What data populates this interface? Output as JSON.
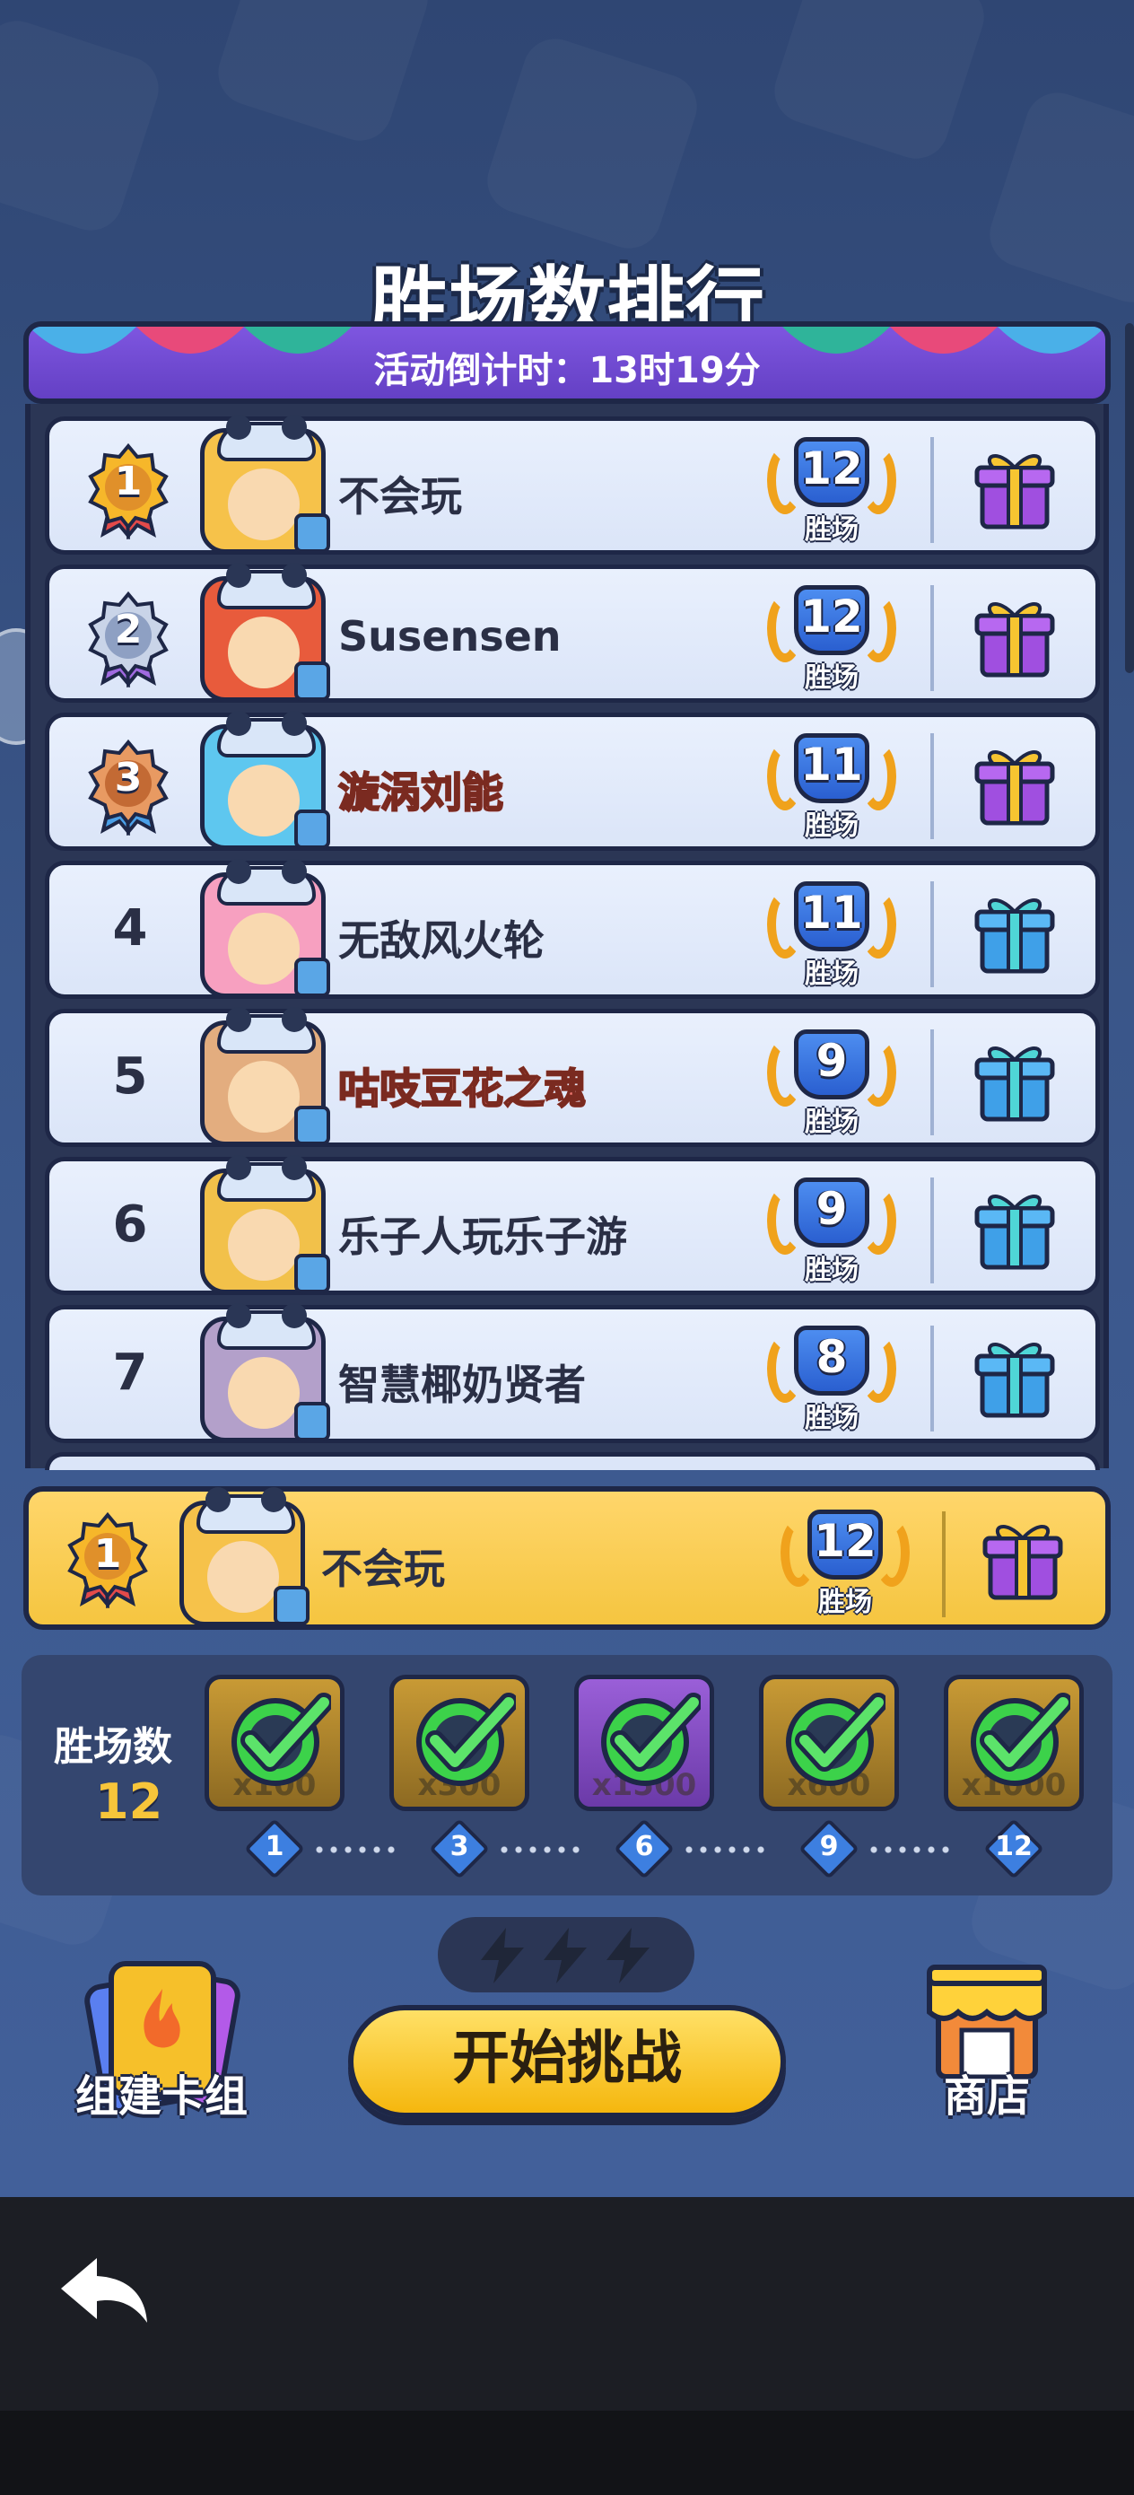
{
  "header": {
    "title": "胜场数排行",
    "countdown": "活动倒计时：13时19分"
  },
  "leaderboard": [
    {
      "rank": "1",
      "medal": "gold",
      "name": "不会玩",
      "wins": "12",
      "wins_label": "胜场",
      "gift": "purple",
      "avatar_color": "#f6c24a",
      "style": "normal"
    },
    {
      "rank": "2",
      "medal": "silver",
      "name": "Susensen",
      "wins": "12",
      "wins_label": "胜场",
      "gift": "purple",
      "avatar_color": "#e85b3c",
      "style": "normal"
    },
    {
      "rank": "3",
      "medal": "bronze",
      "name": "漩涡刘能",
      "wins": "11",
      "wins_label": "胜场",
      "gift": "purple",
      "avatar_color": "#5ec7ef",
      "style": "special"
    },
    {
      "rank": "4",
      "medal": "",
      "name": "无敌风火轮",
      "wins": "11",
      "wins_label": "胜场",
      "gift": "blue",
      "avatar_color": "#f7a0c0",
      "style": "normal"
    },
    {
      "rank": "5",
      "medal": "",
      "name": "咕吱豆花之魂",
      "wins": "9",
      "wins_label": "胜场",
      "gift": "blue",
      "avatar_color": "#e3ad7f",
      "style": "special"
    },
    {
      "rank": "6",
      "medal": "",
      "name": "乐子人玩乐子游",
      "wins": "9",
      "wins_label": "胜场",
      "gift": "blue",
      "avatar_color": "#f2c14a",
      "style": "normal"
    },
    {
      "rank": "7",
      "medal": "",
      "name": "智慧椰奶贤者",
      "wins": "8",
      "wins_label": "胜场",
      "gift": "blue",
      "avatar_color": "#b3a0ca",
      "style": "normal"
    }
  ],
  "self_entry": {
    "rank": "1",
    "name": "不会玩",
    "wins": "12",
    "wins_label": "胜场"
  },
  "progress": {
    "label": "胜场数",
    "value": "12",
    "rewards": [
      {
        "milestone": "1",
        "amount": "x100",
        "tier": "gold",
        "claimed": true
      },
      {
        "milestone": "3",
        "amount": "x300",
        "tier": "gold",
        "claimed": true
      },
      {
        "milestone": "6",
        "amount": "x1500",
        "tier": "purple",
        "claimed": true
      },
      {
        "milestone": "9",
        "amount": "x600",
        "tier": "gold",
        "claimed": true
      },
      {
        "milestone": "12",
        "amount": "x1000",
        "tier": "gold",
        "claimed": true
      }
    ]
  },
  "actions": {
    "deck_label": "组建卡组",
    "start_label": "开始挑战",
    "shop_label": "商店"
  },
  "colors": {
    "accent_gold": "#f5c540",
    "panel_navy": "#1e2747",
    "win_blue": "#2a5fd0",
    "check_green": "#3cd24a"
  },
  "icons": {
    "back": "back-arrow-icon",
    "gift": "gift-icon",
    "bolt": "lightning-icon",
    "deck": "flame-card-icon",
    "shop": "shop-stall-icon"
  }
}
